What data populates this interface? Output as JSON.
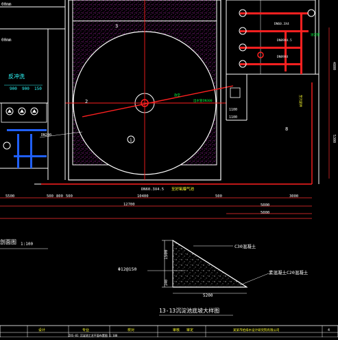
{
  "drawing": {
    "colors": {
      "background": "#000000",
      "wall": "#ffffff",
      "magenta_hatch": "#c020c0",
      "pipe": "#ff2020",
      "dimension": "#ff3030",
      "text_green": "#00ff40",
      "text_yellow": "#ffff30",
      "text_cyan": "#30ffff",
      "text_white": "#ffffff"
    },
    "top_left_labels": [
      "00mm",
      "00mm"
    ],
    "left_panel": {
      "title": "反冲洗",
      "dims": [
        "900",
        "900",
        "150"
      ],
      "note": "DN200"
    },
    "callouts": {
      "pipe_dn": "DN60.3X4.5",
      "pipe_label": "至好氧曝气池",
      "upper_right_dn": [
        "DN60.3X4",
        "DN89X4.5",
        "DN89X4"
      ],
      "overflow": "溢流管",
      "valve_label": "放空",
      "right_pipe_label": "至污泥井",
      "mid_pipe_label": "出水管",
      "mid_pipe_label_2": "DN300",
      "section_ref": "2",
      "section_ref_top": "3",
      "right_tag": "8",
      "center_tag": "1",
      "dim_1100": "1100",
      "dim_1100b": "1100"
    },
    "dimensions": {
      "top_row": [
        "5500",
        "500",
        "800",
        "500",
        "10400",
        "500",
        "3000"
      ],
      "mid_row": [
        "12700"
      ],
      "right_row": [
        "5000",
        "5000"
      ],
      "right_vertical": [
        "4800",
        "5300"
      ]
    },
    "section_left_label": "剖面图",
    "section_left_scale": "1:100",
    "section_detail": {
      "concrete_top": "C30混凝土",
      "rebar": "Φ12@150",
      "concrete_bottom": "素混凝土C20混凝土",
      "width": "5200",
      "height": "1500",
      "small_dim": "240",
      "title": "13-13沉淀池底坡大样图"
    },
    "title_block": {
      "cells": [
        "设计",
        "专业",
        "校对",
        "审核",
        "审定"
      ],
      "company": "某某市给排水设计研究院有限公司",
      "project_number": "4",
      "footer_line": "ZXS-01 沉淀池工艺平面布置图 1:100"
    }
  }
}
